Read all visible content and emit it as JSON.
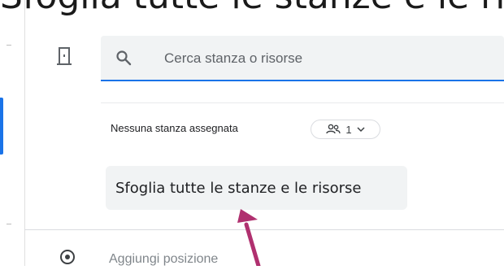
{
  "caption": {
    "text": "Sfoglia tutte le stanze e le risorse"
  },
  "search": {
    "placeholder": "Cerca stanza o risorse",
    "value": ""
  },
  "rooms": {
    "none_assigned_label": "Nessuna stanza assegnata",
    "people_count": "1"
  },
  "browse": {
    "label": "Sfoglia tutte le stanze e le risorse"
  },
  "location": {
    "placeholder": "Aggiungi posizione"
  },
  "colors": {
    "accent": "#1a73e8",
    "annotation_arrow": "#b0306f",
    "field_bg": "#f1f3f4"
  },
  "icons": {
    "room": "door-icon",
    "search": "search-icon",
    "people": "people-icon",
    "chevron": "chevron-down-icon",
    "location": "location-pin-icon"
  }
}
